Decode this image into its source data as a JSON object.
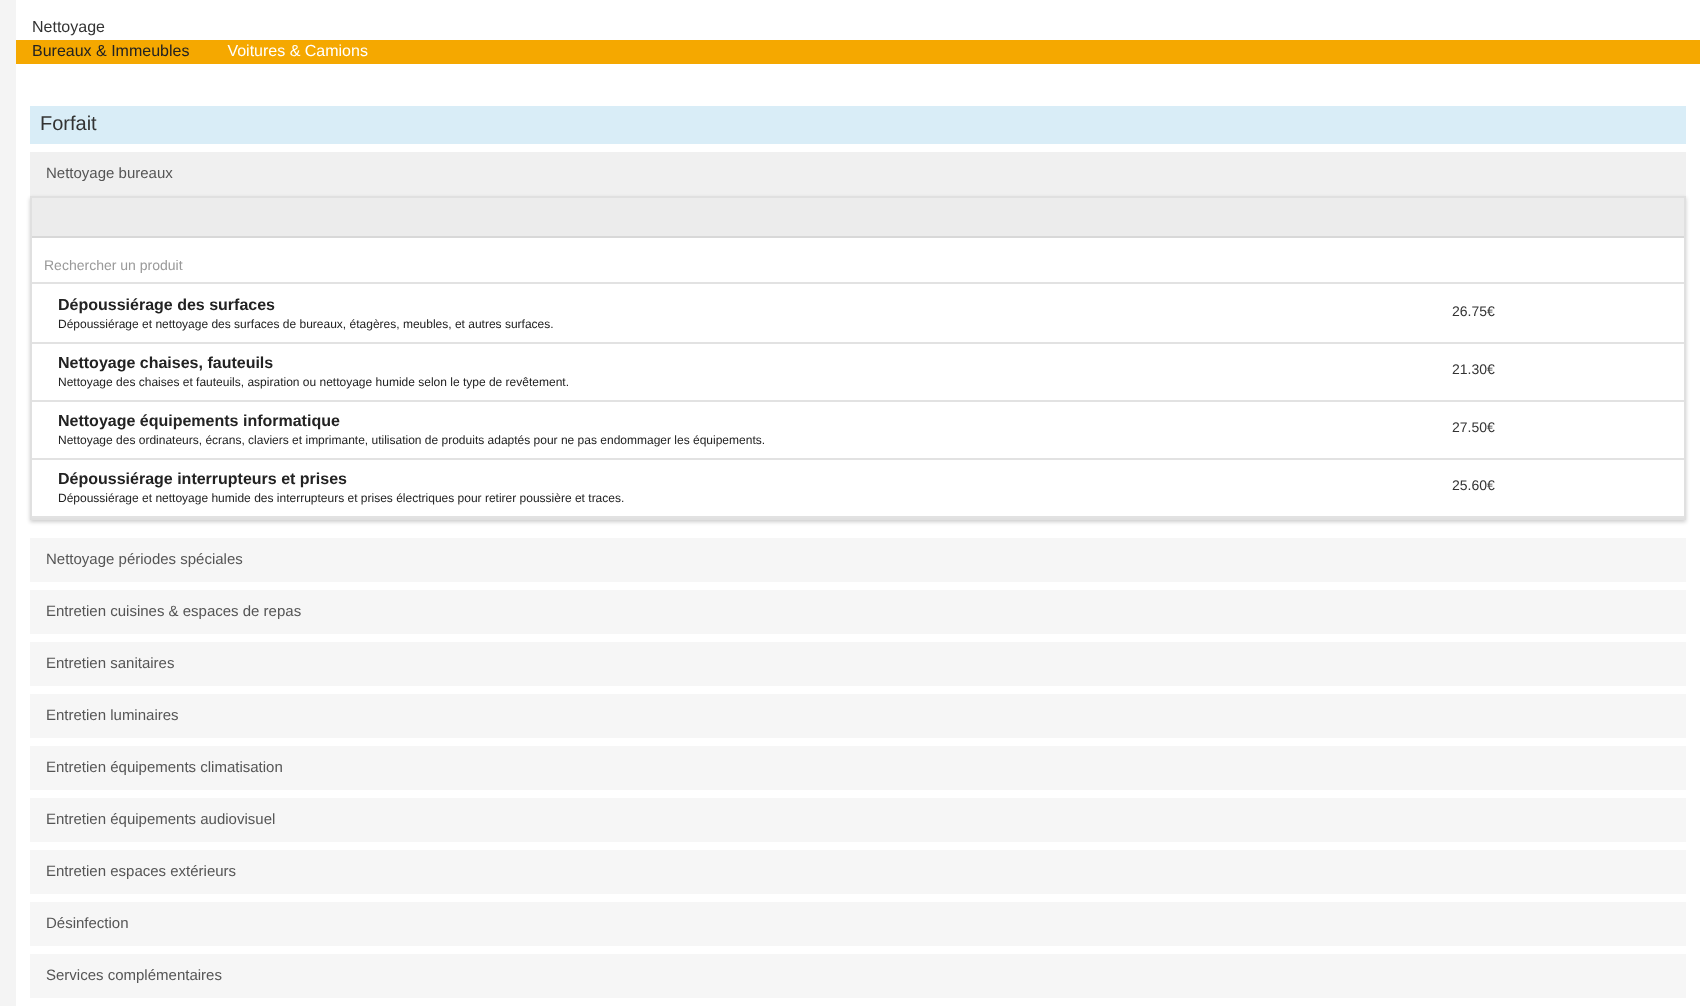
{
  "page_title": "Nettoyage",
  "tabs": [
    {
      "label": "Bureaux & Immeubles",
      "selected": true
    },
    {
      "label": "Voitures & Camions",
      "selected": false
    }
  ],
  "section_title": "Forfait",
  "categories": [
    {
      "label": "Nettoyage bureaux",
      "expanded": true,
      "search": {
        "placeholder": "Rechercher un produit"
      },
      "products": [
        {
          "name": "Dépoussiérage des surfaces",
          "description": "Dépoussiérage et nettoyage des surfaces de bureaux, étagères, meubles, et autres surfaces.",
          "price": "26.75€"
        },
        {
          "name": "Nettoyage chaises, fauteuils",
          "description": "Nettoyage des chaises et fauteuils, aspiration ou nettoyage humide selon le type de revêtement.",
          "price": "21.30€"
        },
        {
          "name": "Nettoyage équipements informatique",
          "description": "Nettoyage des ordinateurs, écrans, claviers et imprimante, utilisation de produits adaptés pour ne pas endommager les équipements.",
          "price": "27.50€"
        },
        {
          "name": "Dépoussiérage interrupteurs et prises",
          "description": "Dépoussiérage et nettoyage humide des interrupteurs et prises électriques pour retirer poussière et traces.",
          "price": "25.60€"
        }
      ]
    },
    {
      "label": "Nettoyage périodes spéciales",
      "expanded": false
    },
    {
      "label": "Entretien cuisines & espaces de repas",
      "expanded": false
    },
    {
      "label": "Entretien sanitaires",
      "expanded": false
    },
    {
      "label": "Entretien luminaires",
      "expanded": false
    },
    {
      "label": "Entretien équipements climatisation",
      "expanded": false
    },
    {
      "label": "Entretien équipements audiovisuel",
      "expanded": false
    },
    {
      "label": "Entretien espaces extérieurs",
      "expanded": false
    },
    {
      "label": "Désinfection",
      "expanded": false
    },
    {
      "label": "Services complémentaires",
      "expanded": false
    }
  ]
}
